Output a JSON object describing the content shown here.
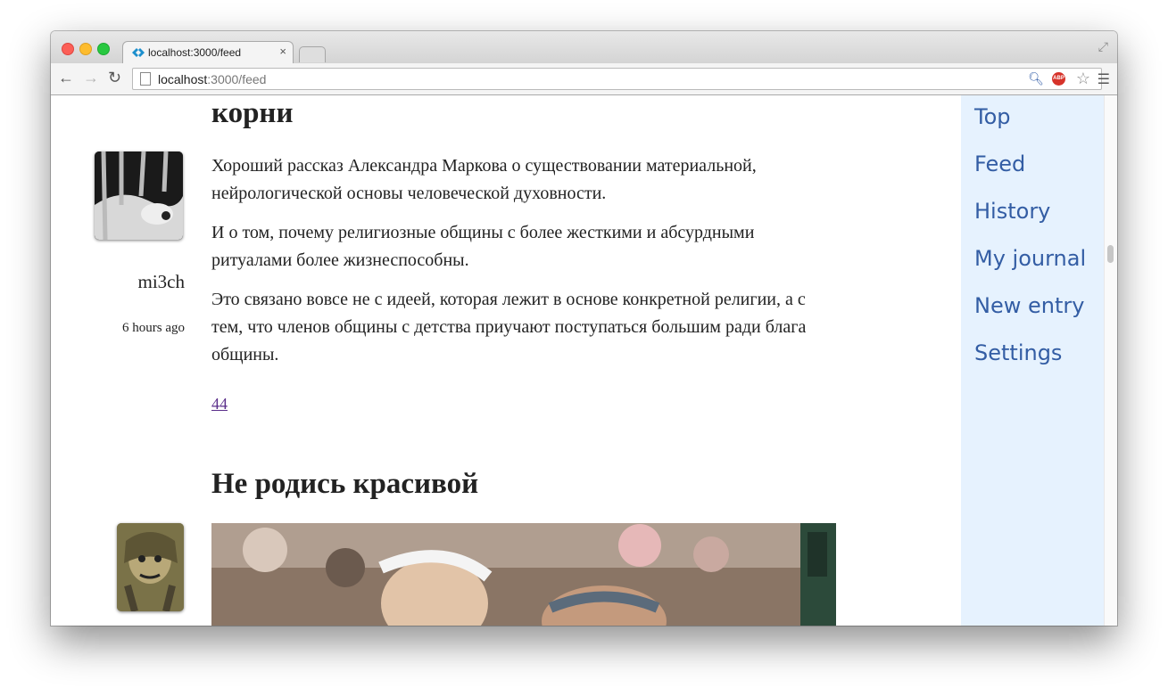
{
  "browser": {
    "tab_title": "localhost:3000/feed",
    "url_host": "localhost",
    "url_rest": ":3000/feed",
    "abp_label": "ABP"
  },
  "posts": [
    {
      "title": "корни",
      "author": "mi3ch",
      "time": "6 hours ago",
      "paragraphs": [
        "Хороший рассказ Александра Маркова о существовании материальной, нейрологической основы человеческой духовности.",
        "И о том, почему религиозные общины с более жесткими и абсурдными ритуалами более жизнеспособны.",
        "Это связано вовсе не с идеей, которая лежит в основе конкретной религии, а с тем, что членов общины с детства приучают поступаться большим ради блага общины."
      ],
      "comments": "44"
    },
    {
      "title": "Не родись красивой"
    }
  ],
  "sidebar": {
    "items": [
      "Top",
      "Feed",
      "History",
      "My journal",
      "New entry",
      "Settings"
    ]
  }
}
